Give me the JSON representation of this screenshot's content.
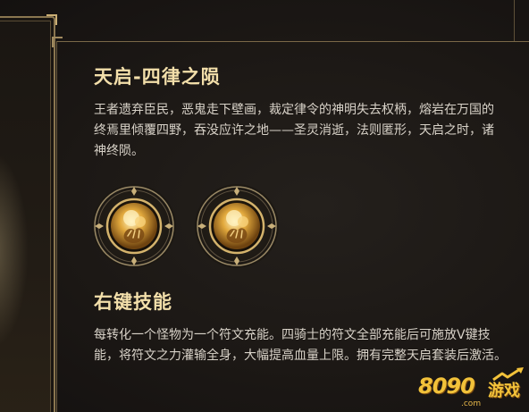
{
  "skill": {
    "title": "天启-四律之陨",
    "description": "王者遗弃臣民，恶鬼走下壁画，裁定律令的神明失去权柄，熔岩在万国的终焉里倾覆四野，吞没应许之地——圣灵消逝，法则匿形，天启之时，诸神终陨。"
  },
  "runes": [
    {
      "icon": "hand-orb-rune-icon"
    },
    {
      "icon": "hand-orb-rune-icon"
    }
  ],
  "right_click": {
    "title": "右键技能",
    "description": "每转化一个怪物为一个符文充能。四骑士的符文全部充能后可施放V键技能，将符文之力灌输全身，大幅提高血量上限。拥有完整天启套装后激活。"
  },
  "watermark": {
    "number": "8090",
    "text": "游戏",
    "domain": ".com"
  },
  "colors": {
    "accent_gold": "#f3dfaa",
    "frame": "#8a7650",
    "watermark": "#f2c23a"
  }
}
